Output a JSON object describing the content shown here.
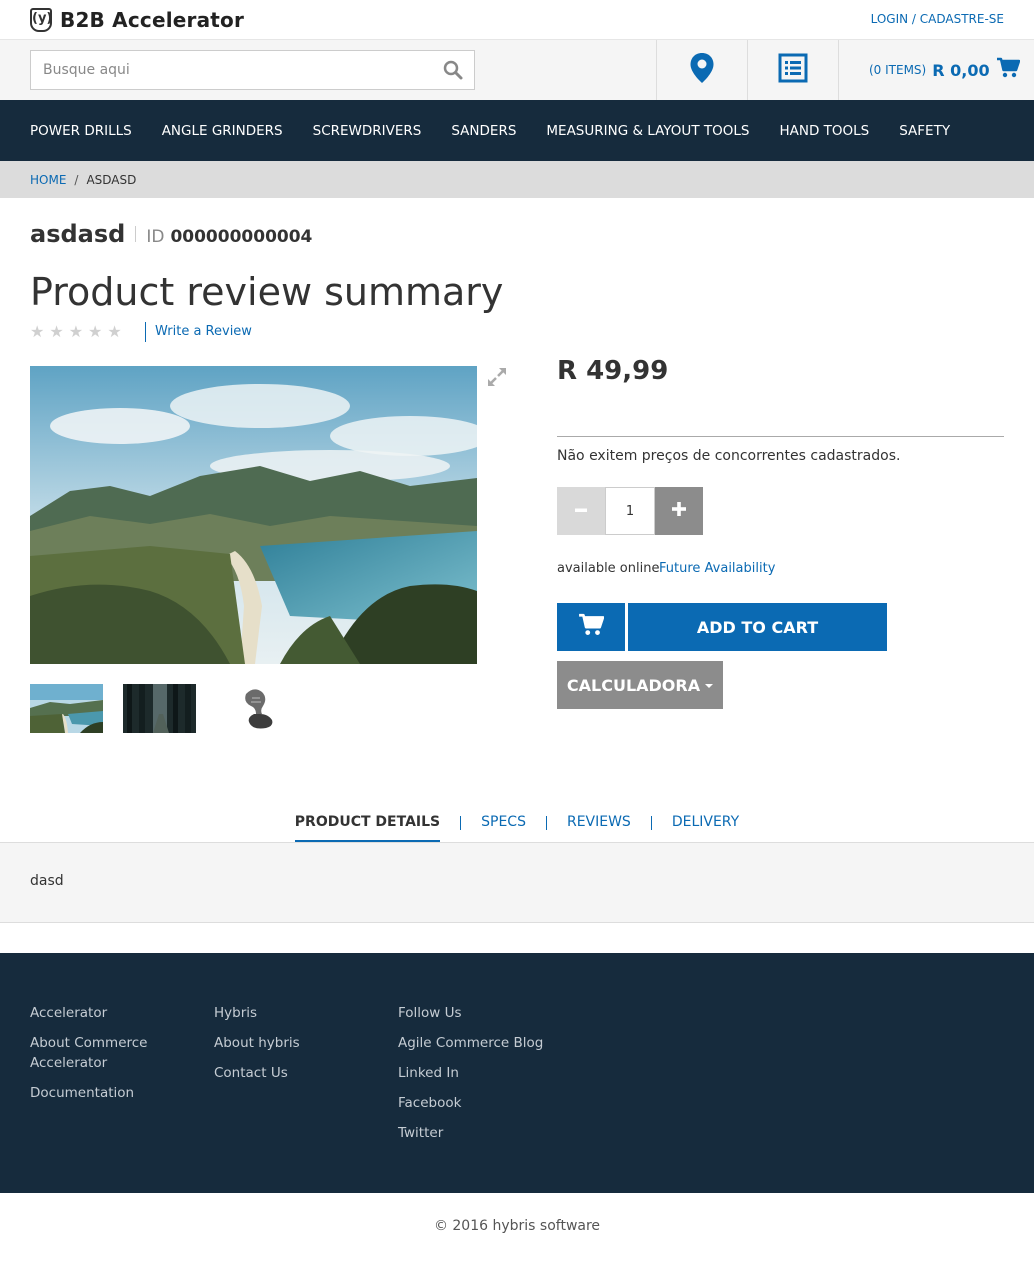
{
  "header": {
    "logo_text": "B2B Accelerator",
    "logo_mark": "(y)",
    "login_label": "LOGIN / CADASTRE-SE"
  },
  "search": {
    "placeholder": "Busque aqui"
  },
  "cart": {
    "items_label": "(0 ITEMS)",
    "total": "R 0,00"
  },
  "nav": {
    "items": [
      "POWER DRILLS",
      "ANGLE GRINDERS",
      "SCREWDRIVERS",
      "SANDERS",
      "MEASURING & LAYOUT TOOLS",
      "HAND TOOLS",
      "SAFETY"
    ]
  },
  "breadcrumb": {
    "home": "HOME",
    "separator": "/",
    "current": "ASDASD"
  },
  "product": {
    "name": "asdasd",
    "id_label": "ID",
    "id_value": "000000000004",
    "review_title": "Product review summary",
    "rating_stars": 0,
    "star_glyph": "★",
    "write_review": "Write a Review",
    "price": "R 49,99",
    "competitors_text": "Não exitem preços de concorrentes cadastrados.",
    "quantity": "1",
    "availability": "available online",
    "future_availability": "Future Availability",
    "add_to_cart": "ADD TO CART",
    "calculator": "CALCULADORA"
  },
  "tabs": {
    "items": [
      "PRODUCT DETAILS",
      "SPECS",
      "REVIEWS",
      "DELIVERY"
    ],
    "active": "PRODUCT DETAILS",
    "content": "dasd"
  },
  "footer": {
    "col1": [
      "Accelerator",
      "About Commerce Accelerator",
      "Documentation"
    ],
    "col2": [
      "Hybris",
      "About hybris",
      "Contact Us"
    ],
    "col3": [
      "Follow Us",
      "Agile Commerce Blog",
      "Linked In",
      "Facebook",
      "Twitter"
    ],
    "copyright": "© 2016 hybris software"
  },
  "colors": {
    "brand_blue": "#0b6ab3",
    "nav_bg": "#162b3d",
    "button_grey": "#8c8c8c"
  }
}
